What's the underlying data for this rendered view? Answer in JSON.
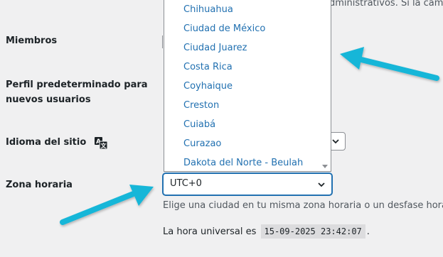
{
  "top_partial_text": "dministrativos. Si la camb",
  "labels": {
    "members": "Miembros",
    "default_role_line1": "Perfil predeterminado para",
    "default_role_line2": "nuevos usuarios",
    "site_language": "Idioma del sitio",
    "timezone": "Zona horaria"
  },
  "timezone": {
    "selected": "UTC+0",
    "options": [
      "Chihuahua",
      "Ciudad de México",
      "Ciudad Juarez",
      "Costa Rica",
      "Coyhaique",
      "Creston",
      "Cuiabá",
      "Curazao",
      "Dakota del Norte - Beulah"
    ],
    "description": "Elige una ciudad en tu misma zona horaria o un desfase horario",
    "utc_prefix": "La hora universal es",
    "utc_time": "15-09-2025 23:42:07",
    "utc_suffix": "."
  },
  "icons": {
    "language": "translation-icon",
    "dropdown_chevron": "chevron-down-icon",
    "annotation": "arrow-pointer-icon"
  },
  "colors": {
    "page_bg": "#f0f0f1",
    "link": "#2271b1",
    "focus_border": "#2271b1",
    "annotation_arrow": "#19b6d8"
  }
}
